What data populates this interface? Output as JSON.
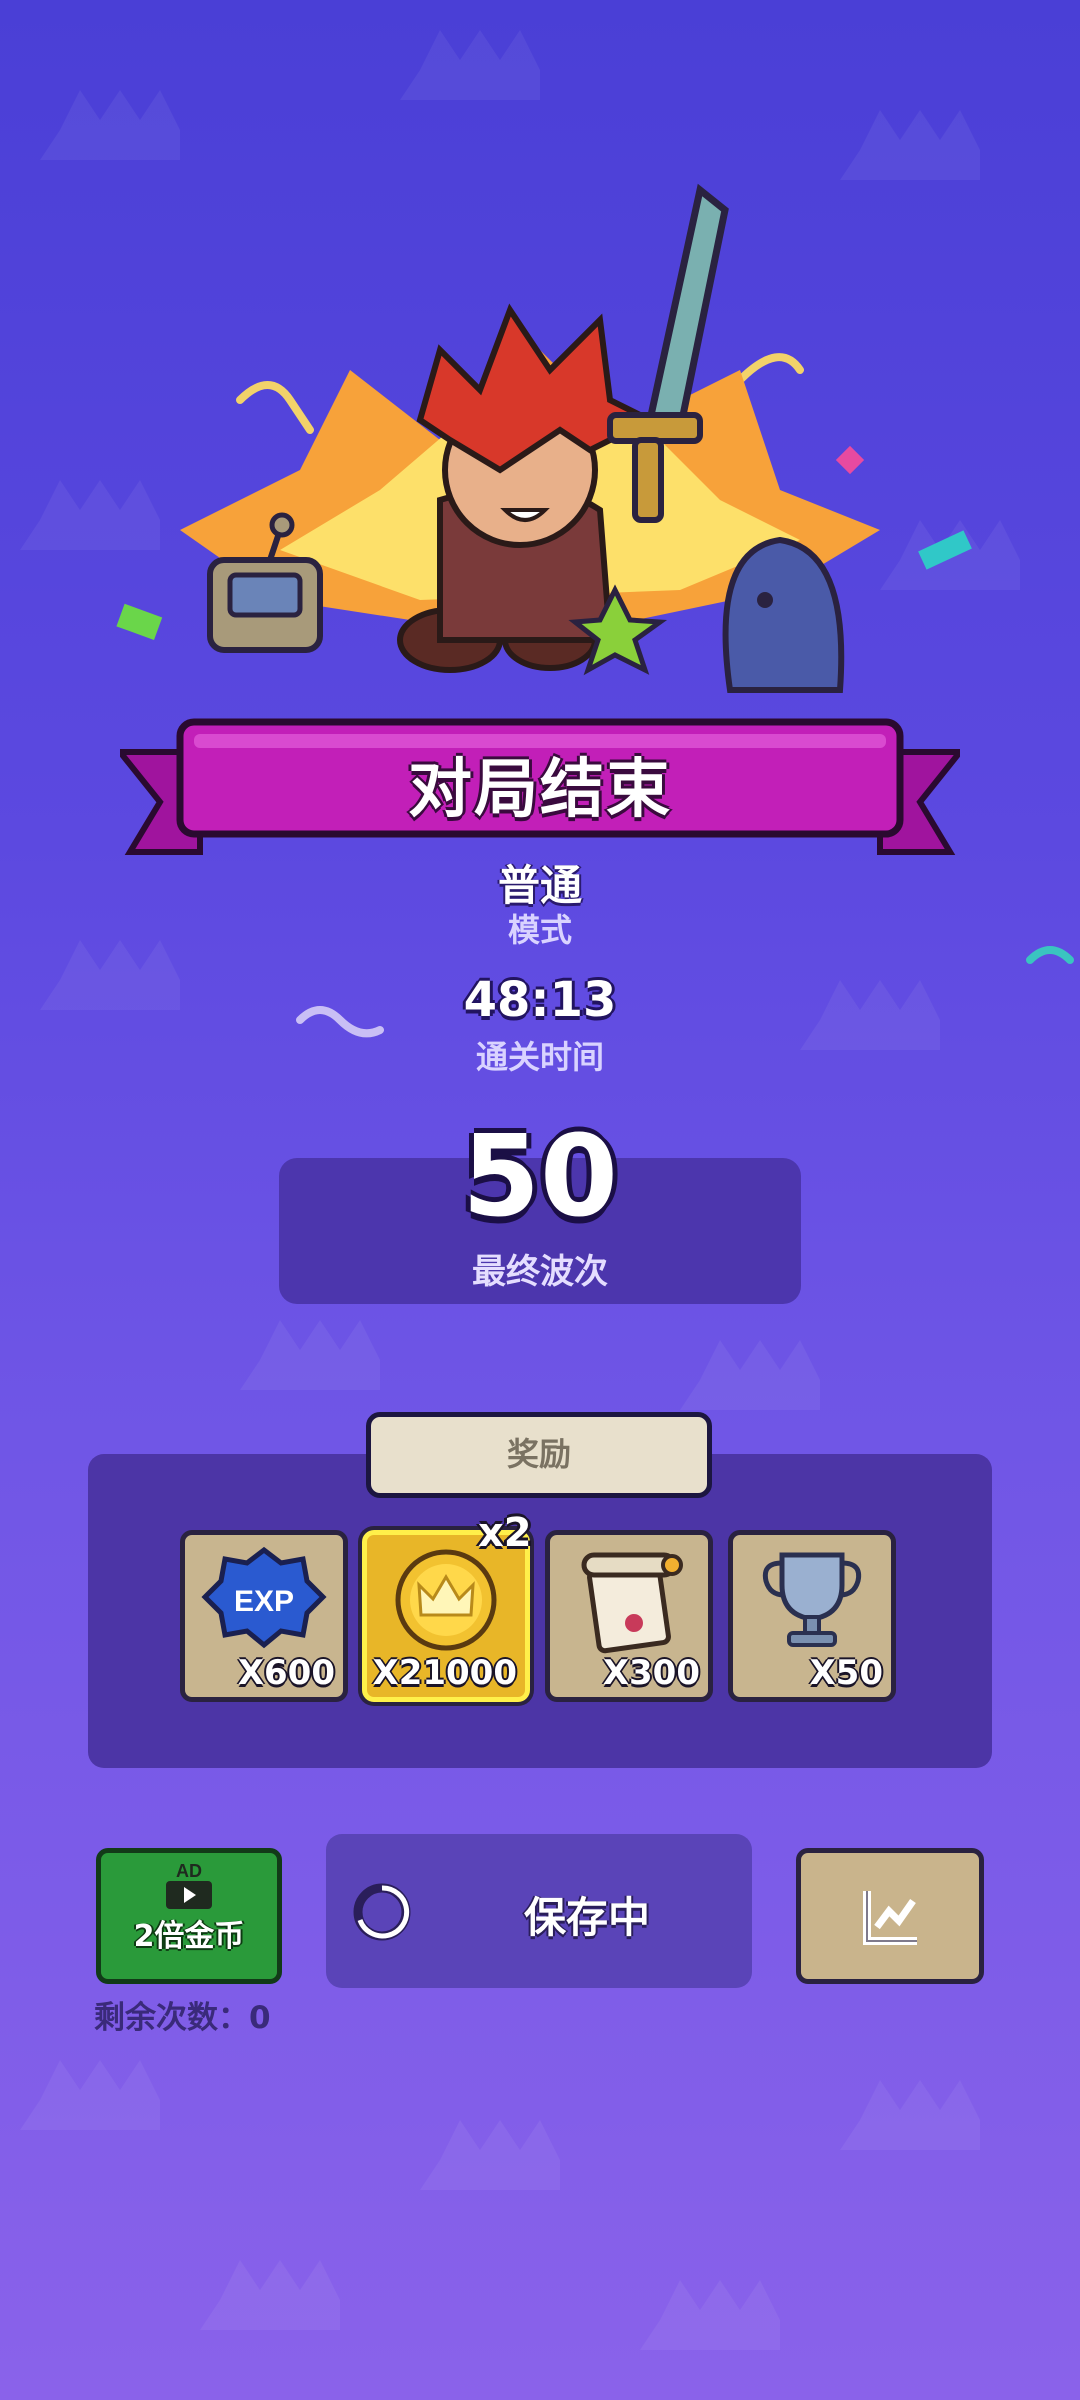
{
  "result": {
    "title": "对局结束",
    "mode_value": "普通",
    "mode_label": "模式",
    "time_value": "48:13",
    "time_label": "通关时间",
    "wave_value": "50",
    "wave_label": "最终波次"
  },
  "rewards": {
    "tab_label": "奖励",
    "multiplier": "x2",
    "items": [
      {
        "icon": "exp-badge-icon",
        "qty": "X600"
      },
      {
        "icon": "gold-crown-coin-icon",
        "qty": "X21000"
      },
      {
        "icon": "scroll-icon",
        "qty": "X300"
      },
      {
        "icon": "trophy-icon",
        "qty": "X50"
      }
    ]
  },
  "actions": {
    "ad_badge": "AD",
    "ad_label": "2倍金币",
    "remaining": "剩余次数：0",
    "save_label": "保存中"
  },
  "colors": {
    "background_top": "#4a3fd6",
    "background_bottom": "#8a62ea",
    "banner": "#c21fb8",
    "ad_button": "#2a9a3a",
    "card": "#c8b58f",
    "gold_card": "#e8b628"
  }
}
